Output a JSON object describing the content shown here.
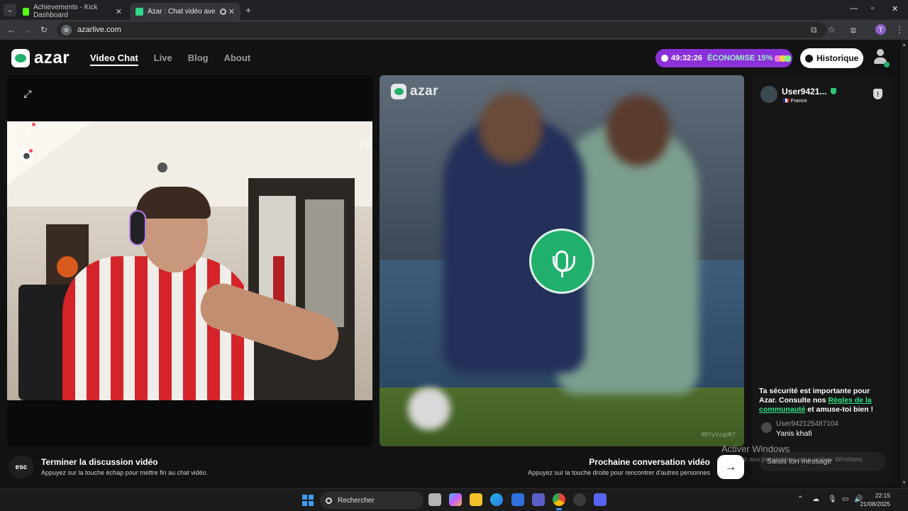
{
  "browser": {
    "tabs": [
      {
        "title": "Achievements - Kick Dashboard",
        "favicon_color": "#53fc18"
      },
      {
        "title": "Azar : Chat vidéo avec de n",
        "favicon_color": "#2ed88a"
      }
    ],
    "url": "azarlive.com",
    "profile_initial": "T"
  },
  "header": {
    "logo": "azar",
    "nav": [
      "Video Chat",
      "Live",
      "Blog",
      "About"
    ],
    "promo_timer": "49:32:26",
    "promo_text": "ÉCONOMISE 15%",
    "history_label": "Historique"
  },
  "partner": {
    "logo": "azar",
    "code": "N5YyVzqUK7"
  },
  "self_video": {
    "watermark": "m"
  },
  "chat": {
    "user_name": "User9421...",
    "country": "France",
    "safety_text_1": "Ta sécurité est importante pour Azar. Consulte nos ",
    "safety_link": "Règles de la communauté",
    "safety_text_2": " et amuse-toi bien !",
    "message_user": "User942125487104",
    "message_text": "Yanis khafi",
    "input_placeholder": "Saisis ton message"
  },
  "controls": {
    "esc_key": "esc",
    "end_title": "Terminer la discussion vidéo",
    "end_sub": "Appuyez sur la touche échap pour mettre fin au chat vidéo.",
    "next_title": "Prochaine conversation vidéo",
    "next_sub": "Appuyez sur la touche droite pour rencontrer d'autres personnes"
  },
  "watermark": {
    "title": "Activer Windows",
    "sub": "Accédez aux paramètres pour activer Windows."
  },
  "taskbar": {
    "search_label": "Rechercher",
    "time": "22:15",
    "date": "21/08/2025"
  },
  "colors": {
    "accent_green": "#21b06c",
    "promo_purple": "#8b30d9",
    "link_green": "#2ee68a"
  }
}
